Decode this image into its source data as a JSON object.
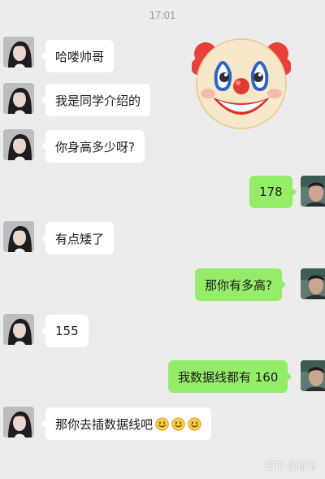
{
  "timestamp": "17:01",
  "messages": [
    {
      "sender": "her",
      "text": "哈喽帅哥"
    },
    {
      "sender": "her",
      "text": "我是同学介绍的"
    },
    {
      "sender": "her",
      "text": "你身高多少呀?"
    },
    {
      "sender": "me",
      "text": "178"
    },
    {
      "sender": "her",
      "text": "有点矮了"
    },
    {
      "sender": "me",
      "text": "那你有多高?"
    },
    {
      "sender": "her",
      "text": "155"
    },
    {
      "sender": "me",
      "text": "我数据线都有 160"
    },
    {
      "sender": "her",
      "text": "那你去插数据线吧",
      "emoji": [
        "smile-emoji",
        "smile-emoji",
        "smile-emoji"
      ]
    }
  ],
  "sticker": {
    "icon": "clown-face-icon"
  },
  "watermark": "知乎 @倔爷",
  "colors": {
    "background": "#ececec",
    "incoming": "#ffffff",
    "outgoing": "#95ec69",
    "timestamp": "#9a9a9a"
  }
}
